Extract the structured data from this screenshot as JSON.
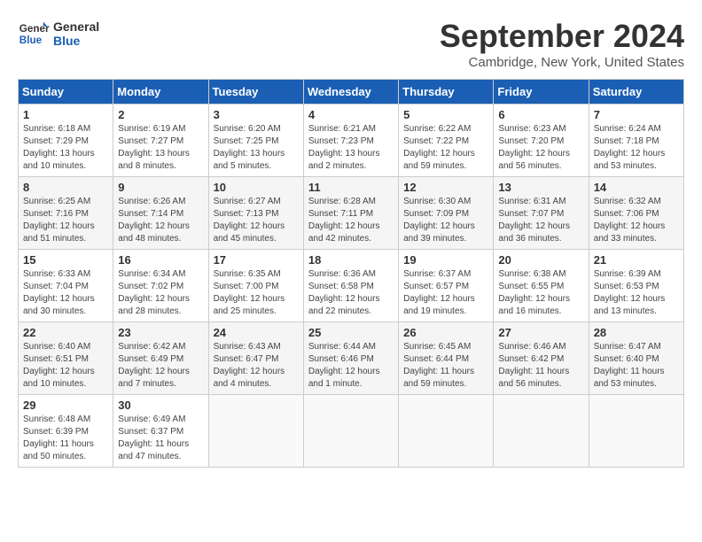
{
  "header": {
    "logo_general": "General",
    "logo_blue": "Blue",
    "month_title": "September 2024",
    "location": "Cambridge, New York, United States"
  },
  "days_of_week": [
    "Sunday",
    "Monday",
    "Tuesday",
    "Wednesday",
    "Thursday",
    "Friday",
    "Saturday"
  ],
  "weeks": [
    [
      {
        "day": "1",
        "sunrise": "6:18 AM",
        "sunset": "7:29 PM",
        "daylight": "13 hours and 10 minutes."
      },
      {
        "day": "2",
        "sunrise": "6:19 AM",
        "sunset": "7:27 PM",
        "daylight": "13 hours and 8 minutes."
      },
      {
        "day": "3",
        "sunrise": "6:20 AM",
        "sunset": "7:25 PM",
        "daylight": "13 hours and 5 minutes."
      },
      {
        "day": "4",
        "sunrise": "6:21 AM",
        "sunset": "7:23 PM",
        "daylight": "13 hours and 2 minutes."
      },
      {
        "day": "5",
        "sunrise": "6:22 AM",
        "sunset": "7:22 PM",
        "daylight": "12 hours and 59 minutes."
      },
      {
        "day": "6",
        "sunrise": "6:23 AM",
        "sunset": "7:20 PM",
        "daylight": "12 hours and 56 minutes."
      },
      {
        "day": "7",
        "sunrise": "6:24 AM",
        "sunset": "7:18 PM",
        "daylight": "12 hours and 53 minutes."
      }
    ],
    [
      {
        "day": "8",
        "sunrise": "6:25 AM",
        "sunset": "7:16 PM",
        "daylight": "12 hours and 51 minutes."
      },
      {
        "day": "9",
        "sunrise": "6:26 AM",
        "sunset": "7:14 PM",
        "daylight": "12 hours and 48 minutes."
      },
      {
        "day": "10",
        "sunrise": "6:27 AM",
        "sunset": "7:13 PM",
        "daylight": "12 hours and 45 minutes."
      },
      {
        "day": "11",
        "sunrise": "6:28 AM",
        "sunset": "7:11 PM",
        "daylight": "12 hours and 42 minutes."
      },
      {
        "day": "12",
        "sunrise": "6:30 AM",
        "sunset": "7:09 PM",
        "daylight": "12 hours and 39 minutes."
      },
      {
        "day": "13",
        "sunrise": "6:31 AM",
        "sunset": "7:07 PM",
        "daylight": "12 hours and 36 minutes."
      },
      {
        "day": "14",
        "sunrise": "6:32 AM",
        "sunset": "7:06 PM",
        "daylight": "12 hours and 33 minutes."
      }
    ],
    [
      {
        "day": "15",
        "sunrise": "6:33 AM",
        "sunset": "7:04 PM",
        "daylight": "12 hours and 30 minutes."
      },
      {
        "day": "16",
        "sunrise": "6:34 AM",
        "sunset": "7:02 PM",
        "daylight": "12 hours and 28 minutes."
      },
      {
        "day": "17",
        "sunrise": "6:35 AM",
        "sunset": "7:00 PM",
        "daylight": "12 hours and 25 minutes."
      },
      {
        "day": "18",
        "sunrise": "6:36 AM",
        "sunset": "6:58 PM",
        "daylight": "12 hours and 22 minutes."
      },
      {
        "day": "19",
        "sunrise": "6:37 AM",
        "sunset": "6:57 PM",
        "daylight": "12 hours and 19 minutes."
      },
      {
        "day": "20",
        "sunrise": "6:38 AM",
        "sunset": "6:55 PM",
        "daylight": "12 hours and 16 minutes."
      },
      {
        "day": "21",
        "sunrise": "6:39 AM",
        "sunset": "6:53 PM",
        "daylight": "12 hours and 13 minutes."
      }
    ],
    [
      {
        "day": "22",
        "sunrise": "6:40 AM",
        "sunset": "6:51 PM",
        "daylight": "12 hours and 10 minutes."
      },
      {
        "day": "23",
        "sunrise": "6:42 AM",
        "sunset": "6:49 PM",
        "daylight": "12 hours and 7 minutes."
      },
      {
        "day": "24",
        "sunrise": "6:43 AM",
        "sunset": "6:47 PM",
        "daylight": "12 hours and 4 minutes."
      },
      {
        "day": "25",
        "sunrise": "6:44 AM",
        "sunset": "6:46 PM",
        "daylight": "12 hours and 1 minute."
      },
      {
        "day": "26",
        "sunrise": "6:45 AM",
        "sunset": "6:44 PM",
        "daylight": "11 hours and 59 minutes."
      },
      {
        "day": "27",
        "sunrise": "6:46 AM",
        "sunset": "6:42 PM",
        "daylight": "11 hours and 56 minutes."
      },
      {
        "day": "28",
        "sunrise": "6:47 AM",
        "sunset": "6:40 PM",
        "daylight": "11 hours and 53 minutes."
      }
    ],
    [
      {
        "day": "29",
        "sunrise": "6:48 AM",
        "sunset": "6:39 PM",
        "daylight": "11 hours and 50 minutes."
      },
      {
        "day": "30",
        "sunrise": "6:49 AM",
        "sunset": "6:37 PM",
        "daylight": "11 hours and 47 minutes."
      },
      null,
      null,
      null,
      null,
      null
    ]
  ],
  "labels": {
    "sunrise": "Sunrise:",
    "sunset": "Sunset:",
    "daylight": "Daylight:"
  }
}
